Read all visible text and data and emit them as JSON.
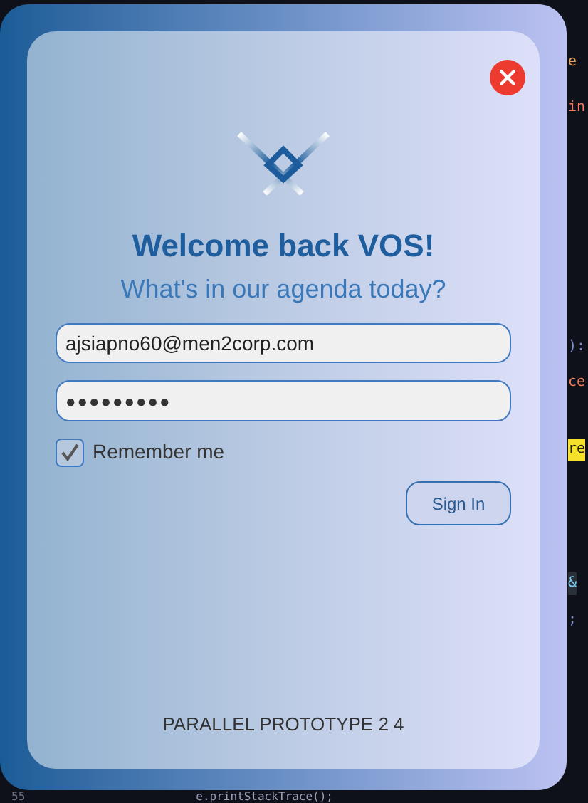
{
  "editor": {
    "fragments": [
      {
        "text": "e",
        "kind": "tab"
      },
      {
        "text": "in",
        "kind": "keyword"
      },
      {
        "text": "):",
        "kind": "plain"
      },
      {
        "text": "ce",
        "kind": "keyword"
      },
      {
        "text": "re",
        "kind": "highlight"
      },
      {
        "text": "&",
        "kind": "selected"
      },
      {
        "text": ";",
        "kind": "plain"
      }
    ],
    "bottom_line": {
      "number": "55",
      "code": "e.printStackTrace();"
    }
  },
  "dialog": {
    "title": "Welcome back VOS!",
    "subtitle": "What's in our agenda today?",
    "email": {
      "value": "ajsiapno60@men2corp.com"
    },
    "password": {
      "value": "●●●●●●●●●"
    },
    "remember": {
      "label": "Remember me",
      "checked": true
    },
    "sign_in": "Sign In",
    "footer": "PARALLEL PROTOTYPE 2 4"
  }
}
